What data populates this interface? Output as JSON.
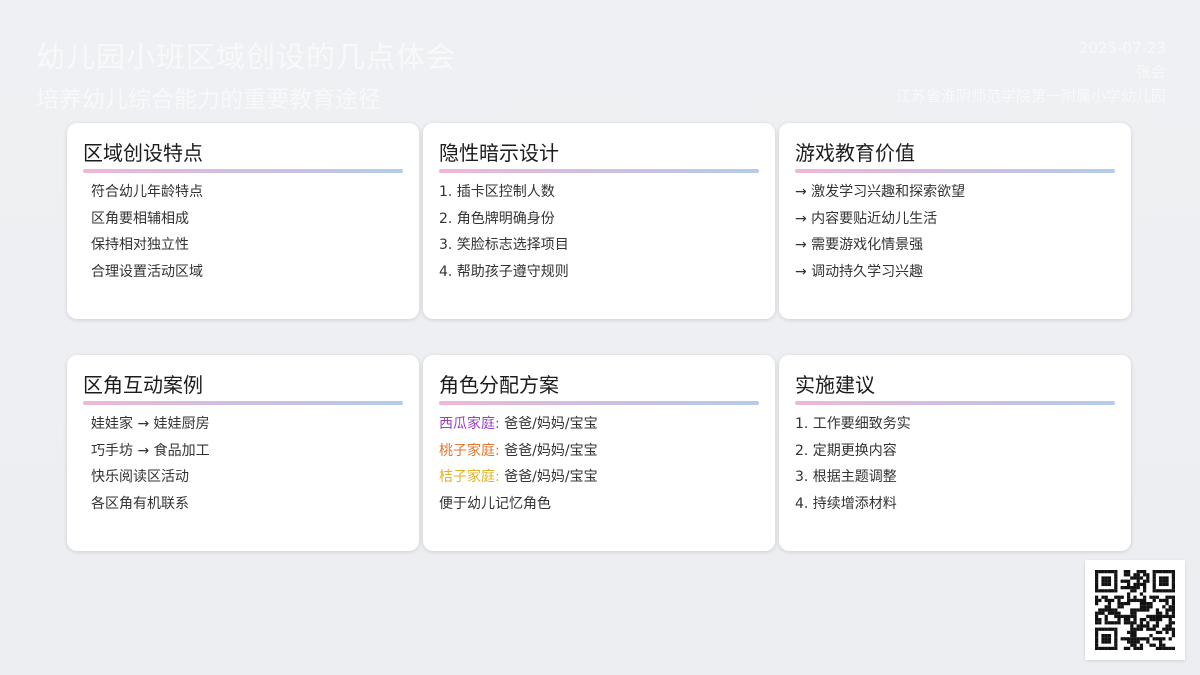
{
  "header": {
    "title": "幼儿园小班区域创设的几点体会",
    "subtitle": "培养幼儿综合能力的重要教育途径",
    "date": "2025-07-23",
    "author": "张会",
    "organization": "江苏省淮阴师范学院第一附属小学幼儿园"
  },
  "cards": [
    {
      "title": "区域创设特点",
      "items": [
        "符合幼儿年龄特点",
        "区角要相辅相成",
        "保持相对独立性",
        "合理设置活动区域"
      ]
    },
    {
      "title": "隐性暗示设计",
      "items": [
        "1. 插卡区控制人数",
        "2. 角色牌明确身份",
        "3. 笑脸标志选择项目",
        "4. 帮助孩子遵守规则"
      ]
    },
    {
      "title": "游戏教育价值",
      "items": [
        "→ 激发学习兴趣和探索欲望",
        "→ 内容要贴近幼儿生活",
        "→ 需要游戏化情景强",
        "→ 调动持久学习兴趣"
      ]
    },
    {
      "title": "区角互动案例",
      "items": [
        "娃娃家 → 娃娃厨房",
        "巧手坊 → 食品加工",
        "快乐阅读区活动",
        "各区角有机联系"
      ]
    },
    {
      "title": "角色分配方案",
      "families": [
        {
          "name": "西瓜家庭:",
          "roles": " 爸爸/妈妈/宝宝",
          "color": "#9b3fc7"
        },
        {
          "name": "桃子家庭:",
          "roles": " 爸爸/妈妈/宝宝",
          "color": "#e0772c"
        },
        {
          "name": "桔子家庭:",
          "roles": " 爸爸/妈妈/宝宝",
          "color": "#e2b325"
        }
      ],
      "note": "便于幼儿记忆角色"
    },
    {
      "title": "实施建议",
      "items": [
        "1. 工作要细致务实",
        "2. 定期更换内容",
        "3. 根据主题调整",
        "4. 持续增添材料"
      ]
    }
  ],
  "qr_code": {
    "icon": "qr-code-icon"
  }
}
